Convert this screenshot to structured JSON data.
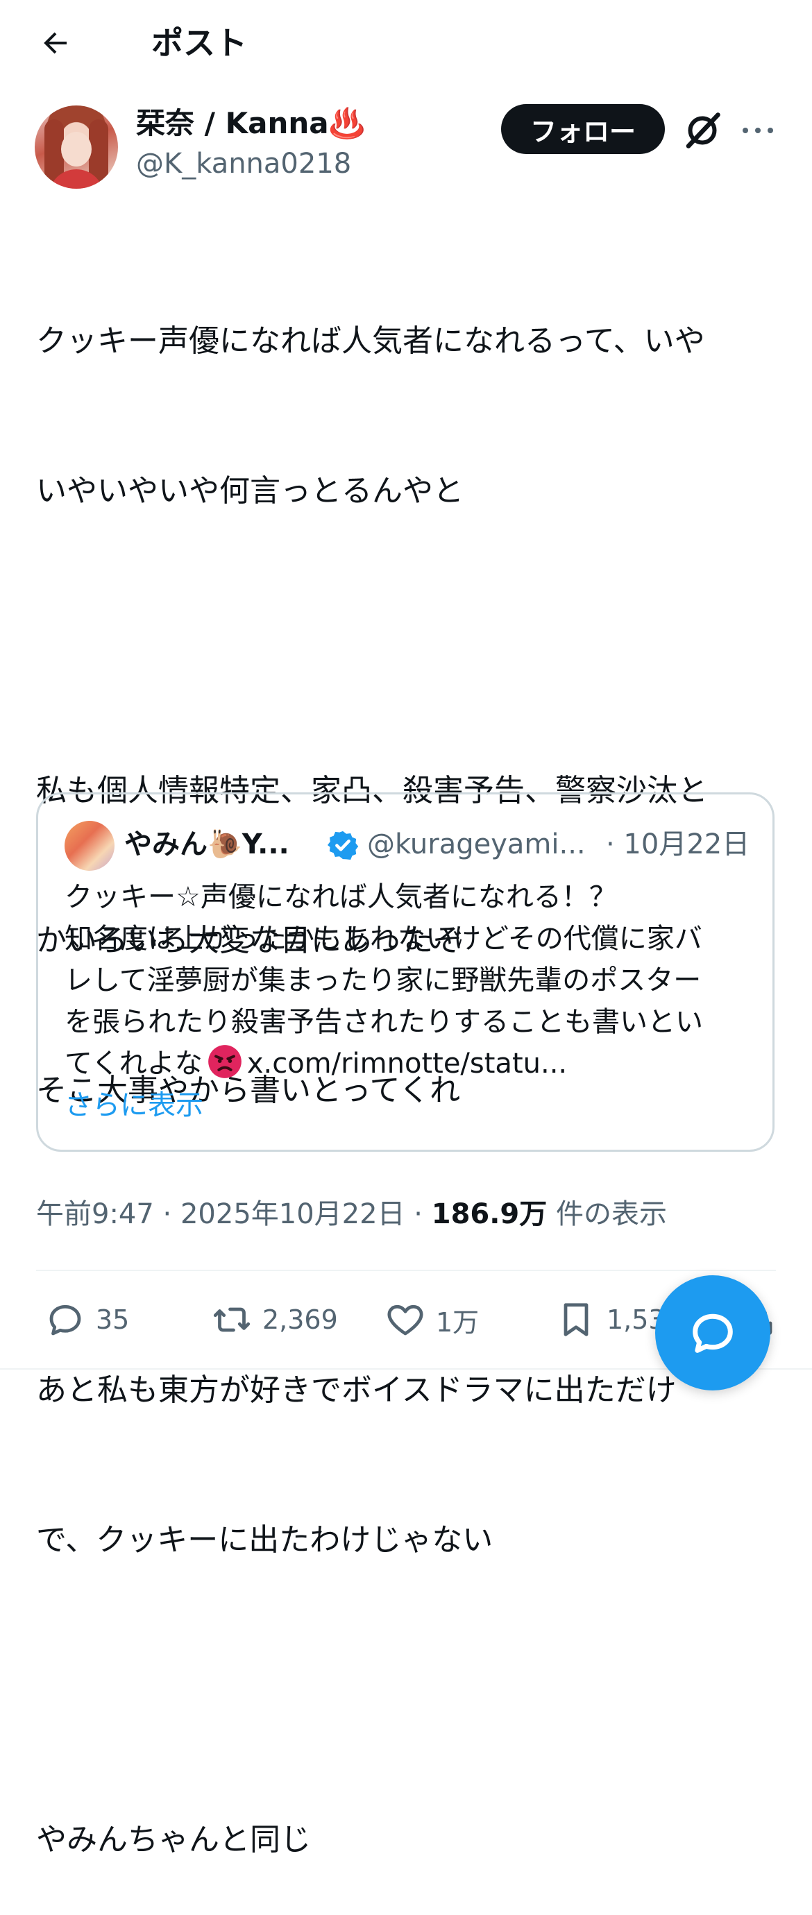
{
  "header": {
    "title": "ポスト"
  },
  "author": {
    "display_name": "栞奈 / Kanna♨️",
    "username": "@K_kanna0218",
    "follow_label": "フォロー"
  },
  "post": {
    "lines": [
      "クッキー声優になれば人気者になれるって、いや",
      "いやいやいや何言っとるんやと",
      "",
      "私も個人情報特定、家凸、殺害予告、警察沙汰と",
      "かいろいろ大変な目にあったぞ",
      "そこ大事やから書いとってくれ",
      "",
      "あと私も東方が好きでボイスドラマに出ただけ",
      "で、クッキーに出たわけじゃない",
      "",
      "やみんちゃんと同じ"
    ]
  },
  "quote": {
    "display_name": "やみん🐌Y...",
    "handle": "@kurageyami...",
    "date": "· 10月22日",
    "lines": [
      "クッキー☆声優になれば人気者になれる！？",
      "知名度は上がったかもしれないけどその代償に家バ",
      "レして淫夢厨が集まったり家に野獣先輩のポスター",
      "を張られたり殺害予告されたりすることも書いとい"
    ],
    "last_line_prefix": "てくれよな",
    "last_line_link": "x.com/rimnotte/statu...",
    "show_more": "さらに表示"
  },
  "meta": {
    "time": "午前9:47",
    "sep1": " · ",
    "date": "2025年10月22日",
    "sep2": " · ",
    "views_count": "186.9万",
    "views_label": " 件の表示"
  },
  "actions": {
    "replies": "35",
    "retweets": "2,369",
    "likes": "1万",
    "bookmarks": "1,535"
  },
  "colors": {
    "accent": "#1d9bf0",
    "text": "#0f1419",
    "secondary": "#536471",
    "border": "#cfd9de"
  }
}
